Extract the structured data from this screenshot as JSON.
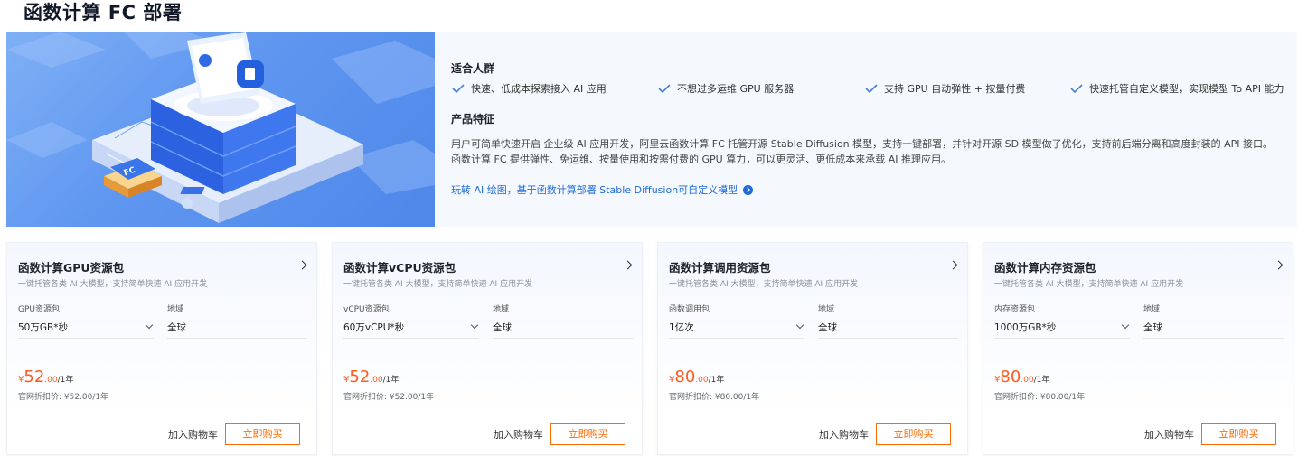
{
  "page": {
    "title": "函数计算 FC 部署"
  },
  "hero": {
    "badge": "FC",
    "audience_title": "适合人群",
    "audience": [
      "快速、低成本探索接入 AI 应用",
      "不想过多运维 GPU 服务器",
      "支持 GPU 自动弹性 + 按量付费",
      "快速托管自定义模型，实现模型 To API 能力"
    ],
    "features_title": "产品特征",
    "features_desc": "用户可简单快速开启 企业级 AI 应用开发，阿里云函数计算 FC 托管开源 Stable Diffusion 模型，支持一键部署，并针对开源 SD 模型做了优化，支持前后端分离和高度封装的 API 接口。函数计算 FC 提供弹性、免运维、按量使用和按需付费的 GPU 算力，可以更灵活、更低成本来承载 AI 推理应用。",
    "link": "玩转 AI 绘图，基于函数计算部署 Stable Diffusion可自定义模型"
  },
  "cards": [
    {
      "title": "函数计算GPU资源包",
      "subtitle": "一键托管各类 AI 大模型，支持简单快速 AI 应用开发",
      "spec_label": "GPU资源包",
      "spec_value": "50万GB*秒",
      "region_label": "地域",
      "region_value": "全球",
      "price_symbol": "¥",
      "price_int": "52",
      "price_dec": ".00",
      "price_per": "/1年",
      "orig_price": "官网折扣价: ¥52.00/1年",
      "cart": "加入购物车",
      "buy": "立即购买"
    },
    {
      "title": "函数计算vCPU资源包",
      "subtitle": "一键托管各类 AI 大模型，支持简单快速 AI 应用开发",
      "spec_label": "vCPU资源包",
      "spec_value": "60万vCPU*秒",
      "region_label": "地域",
      "region_value": "全球",
      "price_symbol": "¥",
      "price_int": "52",
      "price_dec": ".00",
      "price_per": "/1年",
      "orig_price": "官网折扣价: ¥52.00/1年",
      "cart": "加入购物车",
      "buy": "立即购买"
    },
    {
      "title": "函数计算调用资源包",
      "subtitle": "一键托管各类 AI 大模型，支持简单快速 AI 应用开发",
      "spec_label": "函数调用包",
      "spec_value": "1亿次",
      "region_label": "地域",
      "region_value": "全球",
      "price_symbol": "¥",
      "price_int": "80",
      "price_dec": ".00",
      "price_per": "/1年",
      "orig_price": "官网折扣价: ¥80.00/1年",
      "cart": "加入购物车",
      "buy": "立即购买"
    },
    {
      "title": "函数计算内存资源包",
      "subtitle": "一键托管各类 AI 大模型，支持简单快速 AI 应用开发",
      "spec_label": "内存资源包",
      "spec_value": "1000万GB*秒",
      "region_label": "地域",
      "region_value": "全球",
      "price_symbol": "¥",
      "price_int": "80",
      "price_dec": ".00",
      "price_per": "/1年",
      "orig_price": "官网折扣价: ¥80.00/1年",
      "cart": "加入购物车",
      "buy": "立即购买"
    }
  ],
  "colors": {
    "accent": "#ff6a00",
    "price": "#ff5a1f",
    "link": "#1f6bd8",
    "check": "#4a7fd6",
    "hero_bg": "#f5f8fd"
  },
  "icons": {
    "check": "check-icon",
    "card_arrow": "chevron-right-icon",
    "select": "chevron-down-icon",
    "link": "arrow-circle-right-icon"
  }
}
